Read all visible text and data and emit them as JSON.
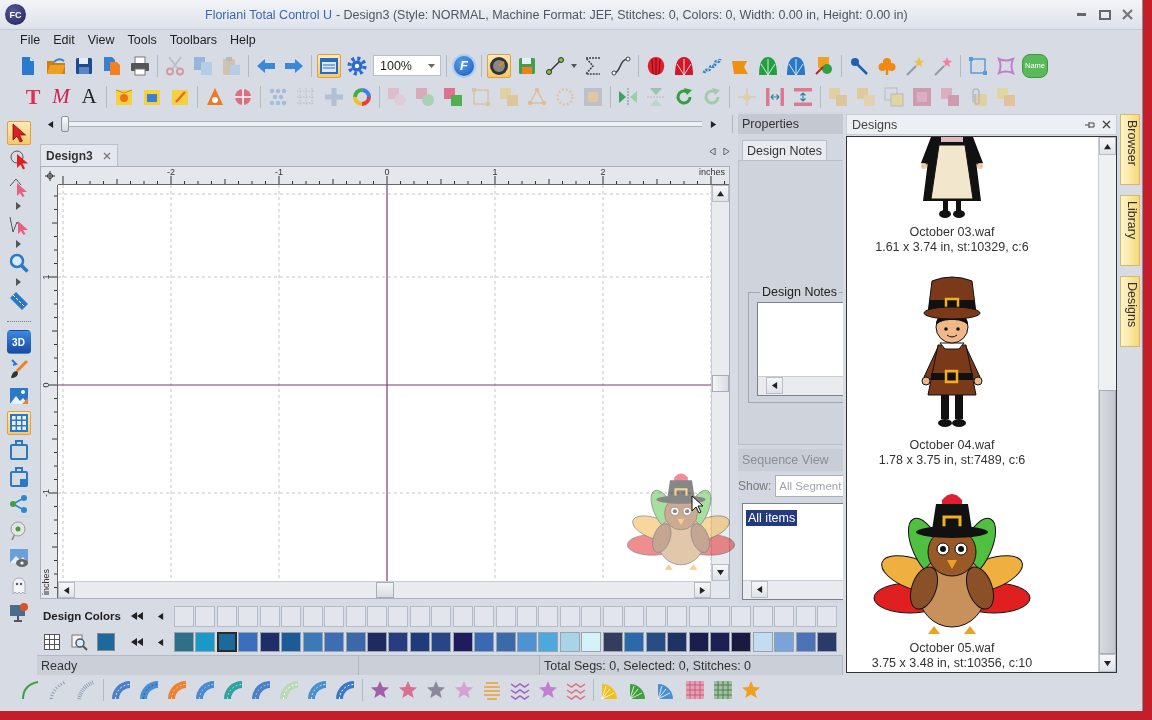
{
  "window": {
    "logo": "FC",
    "app_name": "Floriani Total Control U",
    "title": "- Design3 (Style: NORMAL, Machine Format: JEF, Stitches: 0, Colors: 0, Width: 0.00 in, Height: 0.00 in)"
  },
  "menu": [
    "File",
    "Edit",
    "View",
    "Tools",
    "Toolbars",
    "Help"
  ],
  "toolbar_1": [
    [
      {
        "kind": "icon",
        "pressed": false,
        "disabled": false
      },
      {
        "kind": "icon",
        "pressed": false,
        "disabled": false
      },
      {
        "kind": "icon",
        "pressed": false,
        "disabled": false
      },
      {
        "kind": "icon",
        "pressed": false,
        "disabled": false
      },
      {
        "kind": "icon",
        "pressed": false,
        "disabled": false
      }
    ],
    [
      {
        "kind": "icon",
        "pressed": false,
        "disabled": true
      },
      {
        "kind": "icon",
        "pressed": false,
        "disabled": true
      },
      {
        "kind": "icon",
        "pressed": false,
        "disabled": true
      }
    ],
    [
      {
        "kind": "icon",
        "pressed": false,
        "disabled": false
      },
      {
        "kind": "icon",
        "pressed": false,
        "disabled": false
      }
    ],
    [
      {
        "kind": "icon",
        "pressed": true,
        "disabled": false
      },
      {
        "kind": "icon",
        "pressed": false,
        "disabled": false
      },
      {
        "kind": "combo",
        "value": "100%"
      }
    ],
    [
      {
        "kind": "label",
        "label": "F",
        "pressed": false,
        "disabled": false
      }
    ],
    [
      {
        "kind": "icon",
        "pressed": true,
        "disabled": false
      },
      {
        "kind": "icon",
        "pressed": false,
        "disabled": false
      },
      {
        "kind": "icon",
        "pressed": false,
        "disabled": false
      },
      {
        "kind": "icon",
        "pressed": false,
        "disabled": false
      },
      {
        "kind": "icon",
        "pressed": false,
        "disabled": false
      }
    ],
    [
      {
        "kind": "icon",
        "pressed": false,
        "disabled": false
      },
      {
        "kind": "icon",
        "pressed": false,
        "disabled": false
      },
      {
        "kind": "icon",
        "pressed": false,
        "disabled": false
      },
      {
        "kind": "icon",
        "pressed": false,
        "disabled": false
      },
      {
        "kind": "icon",
        "pressed": false,
        "disabled": false
      },
      {
        "kind": "icon",
        "pressed": false,
        "disabled": false
      },
      {
        "kind": "icon",
        "pressed": false,
        "disabled": false
      }
    ],
    [
      {
        "kind": "icon",
        "pressed": false,
        "disabled": false
      },
      {
        "kind": "icon",
        "pressed": false,
        "disabled": false
      },
      {
        "kind": "icon",
        "pressed": false,
        "disabled": false
      },
      {
        "kind": "icon",
        "pressed": false,
        "disabled": false
      }
    ],
    [
      {
        "kind": "icon",
        "pressed": false,
        "disabled": false
      },
      {
        "kind": "icon",
        "pressed": false,
        "disabled": false
      },
      {
        "kind": "label",
        "label": "Name",
        "pressed": false,
        "disabled": false
      }
    ]
  ],
  "toolbar_2": [
    [
      {
        "kind": "label",
        "label": "T",
        "pressed": false,
        "disabled": false
      },
      {
        "kind": "label",
        "label": "M",
        "pressed": false,
        "disabled": false
      },
      {
        "kind": "label",
        "label": "A",
        "pressed": false,
        "disabled": false
      }
    ],
    [
      {
        "kind": "icon",
        "pressed": false,
        "disabled": false
      },
      {
        "kind": "icon",
        "pressed": false,
        "disabled": false
      },
      {
        "kind": "icon",
        "pressed": false,
        "disabled": false
      }
    ],
    [
      {
        "kind": "icon",
        "pressed": false,
        "disabled": false
      },
      {
        "kind": "icon",
        "pressed": false,
        "disabled": false
      }
    ],
    [
      {
        "kind": "icon",
        "pressed": false,
        "disabled": true
      },
      {
        "kind": "icon",
        "pressed": false,
        "disabled": true
      },
      {
        "kind": "icon",
        "pressed": false,
        "disabled": true
      },
      {
        "kind": "icon",
        "pressed": false,
        "disabled": false
      }
    ],
    [
      {
        "kind": "icon",
        "pressed": false,
        "disabled": true
      },
      {
        "kind": "icon",
        "pressed": false,
        "disabled": true
      },
      {
        "kind": "icon",
        "pressed": false,
        "disabled": false
      },
      {
        "kind": "icon",
        "pressed": false,
        "disabled": true
      },
      {
        "kind": "icon",
        "pressed": false,
        "disabled": true
      },
      {
        "kind": "icon",
        "pressed": false,
        "disabled": true
      },
      {
        "kind": "icon",
        "pressed": false,
        "disabled": true
      },
      {
        "kind": "icon",
        "pressed": false,
        "disabled": true
      }
    ],
    [
      {
        "kind": "icon",
        "pressed": false,
        "disabled": false
      },
      {
        "kind": "icon",
        "pressed": false,
        "disabled": true
      },
      {
        "kind": "icon",
        "pressed": false,
        "disabled": false
      },
      {
        "kind": "icon",
        "pressed": false,
        "disabled": true
      }
    ],
    [
      {
        "kind": "icon",
        "pressed": false,
        "disabled": true
      },
      {
        "kind": "icon",
        "pressed": false,
        "disabled": false
      },
      {
        "kind": "icon",
        "pressed": false,
        "disabled": false
      }
    ],
    [
      {
        "kind": "icon",
        "pressed": false,
        "disabled": true
      },
      {
        "kind": "icon",
        "pressed": false,
        "disabled": true
      },
      {
        "kind": "icon",
        "pressed": false,
        "disabled": true
      },
      {
        "kind": "icon",
        "pressed": false,
        "disabled": true
      },
      {
        "kind": "icon",
        "pressed": false,
        "disabled": true
      },
      {
        "kind": "icon",
        "pressed": false,
        "disabled": true
      },
      {
        "kind": "icon",
        "pressed": false,
        "disabled": true
      }
    ]
  ],
  "left_toolbar": [
    [
      {
        "kind": "icon",
        "pressed": true
      },
      {
        "kind": "icon",
        "pressed": false
      },
      {
        "kind": "icon",
        "pressed": false
      },
      {
        "kind": "icon",
        "pressed": false
      },
      {
        "kind": "icon",
        "pressed": false
      },
      {
        "kind": "icon",
        "pressed": false
      }
    ],
    [
      {
        "kind": "label",
        "label": "3D",
        "pressed": false
      },
      {
        "kind": "icon",
        "pressed": false
      },
      {
        "kind": "icon",
        "pressed": false
      },
      {
        "kind": "icon",
        "pressed": true
      },
      {
        "kind": "icon",
        "pressed": false
      },
      {
        "kind": "icon",
        "pressed": false
      },
      {
        "kind": "icon",
        "pressed": false
      },
      {
        "kind": "icon",
        "pressed": false
      },
      {
        "kind": "icon",
        "pressed": false
      },
      {
        "kind": "icon",
        "pressed": false
      },
      {
        "kind": "icon",
        "pressed": false
      }
    ]
  ],
  "slider": {
    "level": 0
  },
  "document_tabs": [
    {
      "label": "Design3",
      "selected": true
    }
  ],
  "rulers": {
    "x_labels": [
      "-2",
      "-1",
      "0",
      "1",
      "2"
    ],
    "x_unit": "inches",
    "y_labels": [
      "1",
      "0",
      "-1"
    ],
    "y_unit": "inches"
  },
  "properties": {
    "title": "Properties",
    "tabs": [
      {
        "label": "Design Notes",
        "selected": true
      }
    ],
    "notes_group": "Design Notes",
    "sequence_title": "Sequence View",
    "show_label": "Show:",
    "show_value": "All Segment",
    "items": [
      {
        "label": "All items",
        "selected": true
      }
    ]
  },
  "design_colors": {
    "label": "Design Colors",
    "swatches": [
      {
        "color": "#2e6f8a",
        "selected": false
      },
      {
        "color": "#1a98c8",
        "selected": false
      },
      {
        "color": "#1c6a9c",
        "selected": true
      },
      {
        "color": "#3a6fbf",
        "selected": false
      },
      {
        "color": "#1f2d68",
        "selected": false
      },
      {
        "color": "#1d5a98",
        "selected": false
      },
      {
        "color": "#3a7ab8",
        "selected": false
      },
      {
        "color": "#3d6db2",
        "selected": false
      },
      {
        "color": "#3a68a8",
        "selected": false
      },
      {
        "color": "#1e2a60",
        "selected": false
      },
      {
        "color": "#283c80",
        "selected": false
      },
      {
        "color": "#213a7c",
        "selected": false
      },
      {
        "color": "#2a4488",
        "selected": false
      },
      {
        "color": "#1e1c5c",
        "selected": false
      },
      {
        "color": "#3a68b2",
        "selected": false
      },
      {
        "color": "#3a6aa8",
        "selected": false
      },
      {
        "color": "#4e92d4",
        "selected": false
      },
      {
        "color": "#4ea8e0",
        "selected": false
      },
      {
        "color": "#a8d4ea",
        "selected": false
      },
      {
        "color": "#d4f2f8",
        "selected": false
      },
      {
        "color": "#363c5c",
        "selected": false
      },
      {
        "color": "#2a6aaa",
        "selected": false
      },
      {
        "color": "#284c84",
        "selected": false
      },
      {
        "color": "#1e3264",
        "selected": false
      },
      {
        "color": "#1a1e4c",
        "selected": false
      },
      {
        "color": "#1e2054",
        "selected": false
      },
      {
        "color": "#1a1a40",
        "selected": false
      },
      {
        "color": "#c4dcf0",
        "selected": false
      },
      {
        "color": "#7aa4d8",
        "selected": false
      },
      {
        "color": "#4c72b8",
        "selected": false
      },
      {
        "color": "#2a3a6a",
        "selected": false
      }
    ]
  },
  "status_bar": {
    "message": "Ready",
    "counts": "Total Segs: 0, Selected: 0, Stitches: 0"
  },
  "designs_panel": {
    "title": "Designs",
    "items": [
      {
        "name": "October 03.waf",
        "info": "1.61 x 3.74 in, st:10329, c:6"
      },
      {
        "name": "October 04.waf",
        "info": "1.78 x 3.75 in, st:7489, c:6"
      },
      {
        "name": "October 05.waf",
        "info": "3.75 x 3.48 in, st:10356, c:10"
      }
    ]
  },
  "side_tabs": [
    "Browser",
    "Library",
    "Designs"
  ]
}
